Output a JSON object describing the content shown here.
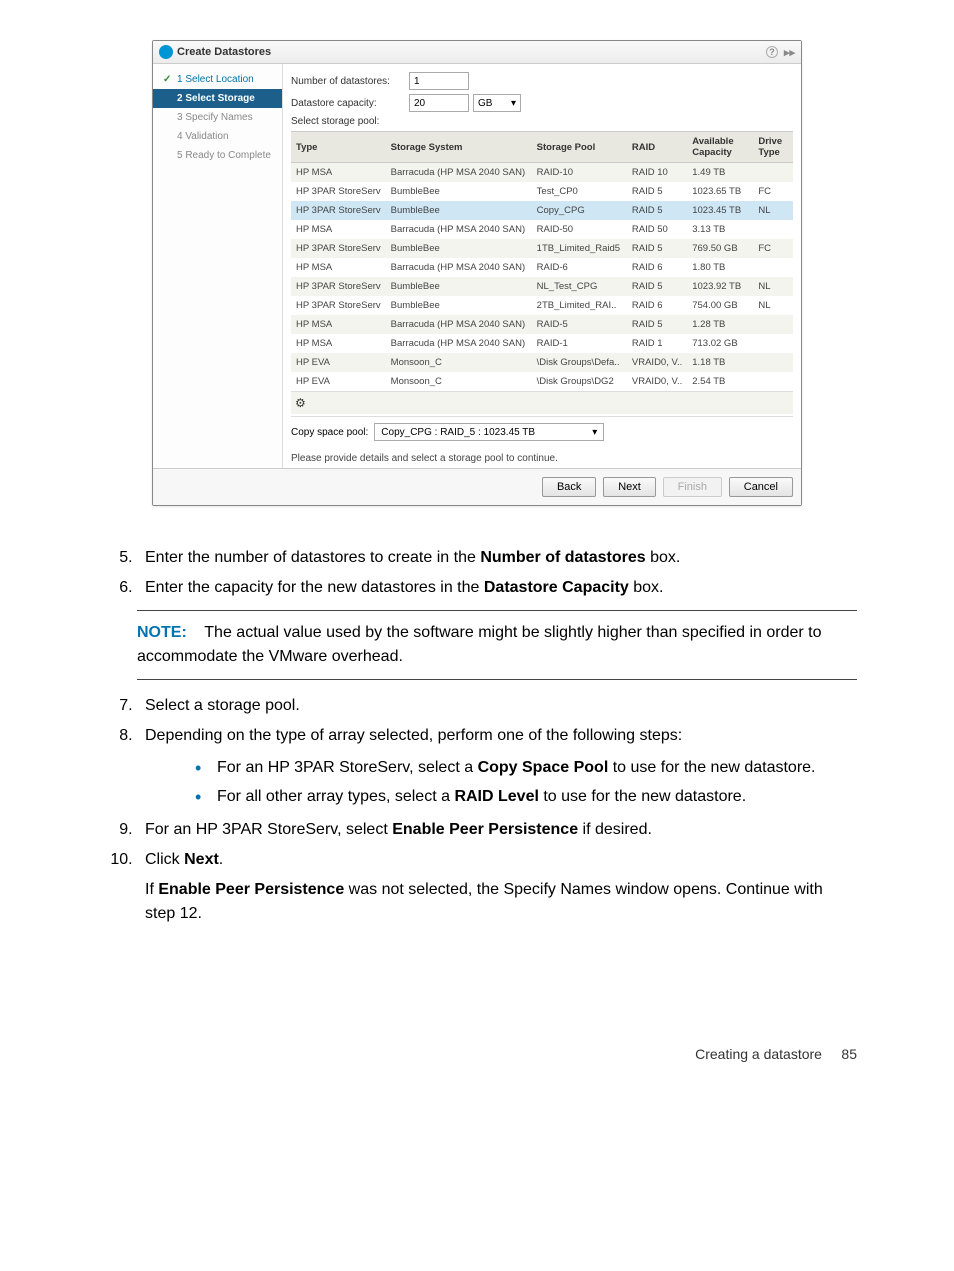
{
  "dialog": {
    "title": "Create Datastores",
    "help": "?",
    "steps": [
      {
        "label": "1  Select Location",
        "state": "done"
      },
      {
        "label": "2  Select Storage",
        "state": "active"
      },
      {
        "label": "3  Specify Names",
        "state": "pending"
      },
      {
        "label": "4  Validation",
        "state": "pending"
      },
      {
        "label": "5  Ready to Complete",
        "state": "pending"
      }
    ],
    "form": {
      "num_label": "Number of datastores:",
      "num_value": "1",
      "cap_label": "Datastore capacity:",
      "cap_value": "20",
      "cap_unit": "GB",
      "pool_label": "Select storage pool:"
    },
    "table": {
      "headers": [
        "Type",
        "Storage System",
        "Storage Pool",
        "RAID",
        "Available Capacity",
        "Drive Type"
      ],
      "rows": [
        {
          "c": [
            "HP MSA",
            "Barracuda (HP MSA 2040 SAN)",
            "RAID-10",
            "RAID 10",
            "1.49 TB",
            ""
          ],
          "alt": true
        },
        {
          "c": [
            "HP 3PAR StoreServ",
            "BumbleBee",
            "Test_CP0",
            "RAID 5",
            "1023.65 TB",
            "FC"
          ],
          "alt": false
        },
        {
          "c": [
            "HP 3PAR StoreServ",
            "BumbleBee",
            "Copy_CPG",
            "RAID 5",
            "1023.45 TB",
            "NL"
          ],
          "sel": true
        },
        {
          "c": [
            "HP MSA",
            "Barracuda (HP MSA 2040 SAN)",
            "RAID-50",
            "RAID 50",
            "3.13 TB",
            ""
          ],
          "alt": false
        },
        {
          "c": [
            "HP 3PAR StoreServ",
            "BumbleBee",
            "1TB_Limited_Raid5",
            "RAID 5",
            "769.50 GB",
            "FC"
          ],
          "alt": true
        },
        {
          "c": [
            "HP MSA",
            "Barracuda (HP MSA 2040 SAN)",
            "RAID-6",
            "RAID 6",
            "1.80 TB",
            ""
          ],
          "alt": false
        },
        {
          "c": [
            "HP 3PAR StoreServ",
            "BumbleBee",
            "NL_Test_CPG",
            "RAID 5",
            "1023.92 TB",
            "NL"
          ],
          "alt": true
        },
        {
          "c": [
            "HP 3PAR StoreServ",
            "BumbleBee",
            "2TB_Limited_RAI..",
            "RAID 6",
            "754.00 GB",
            "NL"
          ],
          "alt": false
        },
        {
          "c": [
            "HP MSA",
            "Barracuda (HP MSA 2040 SAN)",
            "RAID-5",
            "RAID 5",
            "1.28 TB",
            ""
          ],
          "alt": true
        },
        {
          "c": [
            "HP MSA",
            "Barracuda (HP MSA 2040 SAN)",
            "RAID-1",
            "RAID 1",
            "713.02 GB",
            ""
          ],
          "alt": false
        },
        {
          "c": [
            "HP EVA",
            "Monsoon_C",
            "\\Disk Groups\\Defa..",
            "VRAID0, V..",
            "1.18 TB",
            ""
          ],
          "alt": true
        },
        {
          "c": [
            "HP EVA",
            "Monsoon_C",
            "\\Disk Groups\\DG2",
            "VRAID0, V..",
            "2.54 TB",
            ""
          ],
          "alt": false
        }
      ]
    },
    "copy_label": "Copy space pool:",
    "copy_value": "Copy_CPG : RAID_5 : 1023.45 TB",
    "instruction": "Please provide details and select a storage pool to continue.",
    "buttons": {
      "back": "Back",
      "next": "Next",
      "finish": "Finish",
      "cancel": "Cancel"
    }
  },
  "doc": {
    "li5_a": "Enter the number of datastores to create in the ",
    "li5_b": "Number of datastores",
    "li5_c": " box.",
    "li6_a": "Enter the capacity for the new datastores in the ",
    "li6_b": "Datastore Capacity",
    "li6_c": " box.",
    "note_label": "NOTE:",
    "note_body": "The actual value used by the software might be slightly higher than specified in order to accommodate the VMware overhead.",
    "li7": "Select a storage pool.",
    "li8": "Depending on the type of array selected, perform one of the following steps:",
    "li8a_a": "For an HP 3PAR StoreServ, select a ",
    "li8a_b": "Copy Space Pool",
    "li8a_c": " to use for the new datastore.",
    "li8b_a": "For all other array types, select a ",
    "li8b_b": "RAID Level",
    "li8b_c": " to use for the new datastore.",
    "li9_a": "For an HP 3PAR StoreServ, select ",
    "li9_b": "Enable Peer Persistence",
    "li9_c": " if desired.",
    "li10_a": "Click ",
    "li10_b": "Next",
    "li10_c": ".",
    "follow_a": "If ",
    "follow_b": "Enable Peer Persistence",
    "follow_c": " was not selected, the Specify Names window opens. Continue with step 12."
  },
  "footer": {
    "text": "Creating a datastore",
    "page": "85"
  }
}
